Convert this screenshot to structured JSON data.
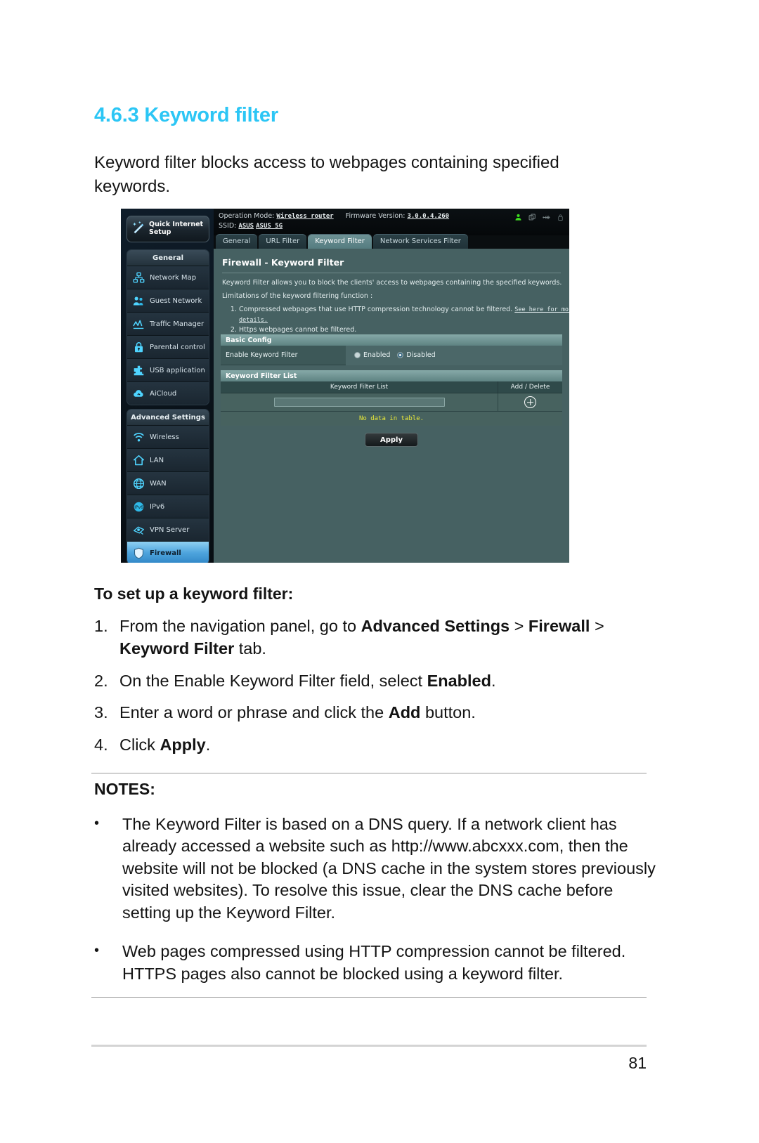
{
  "document": {
    "section_number": "4.6.3",
    "section_title": "Keyword filter",
    "heading": "4.6.3 Keyword filter",
    "intro": "Keyword filter blocks access to webpages containing specified keywords.",
    "howto_heading": "To set up a keyword filter:",
    "page_number": "81",
    "accent_color": "#2CC6F5"
  },
  "steps": [
    {
      "num": "1.",
      "html": "From the navigation panel, go to <b>Advanced Settings</b> &gt; <b>Firewall</b> &gt; <b>Keyword Filter</b> tab."
    },
    {
      "num": "2.",
      "html": "On the Enable Keyword Filter field, select <b>Enabled</b>."
    },
    {
      "num": "3.",
      "html": "Enter a word or phrase and click the <b>Add</b> button."
    },
    {
      "num": "4.",
      "html": "Click <b>Apply</b>."
    }
  ],
  "notes": {
    "title": "NOTES:",
    "items": [
      "The Keyword Filter is based on a DNS query. If a network client has already accessed a website such as http://www.abcxxx.com, then the website will not be blocked (a DNS cache in the system stores previously visited websites). To resolve this issue, clear the DNS cache before setting up the Keyword Filter.",
      "Web pages compressed using HTTP compression cannot be filtered. HTTPS pages also cannot be blocked using a keyword filter."
    ]
  },
  "router_ui": {
    "topbar": {
      "operation_mode_label": "Operation Mode:",
      "operation_mode_value": "Wireless router",
      "firmware_label": "Firmware Version:",
      "firmware_value": "3.0.0.4.260",
      "ssid_label": "SSID:",
      "ssid_value_1": "ASUS",
      "ssid_value_2": "ASUS_5G",
      "icons": [
        "user-icon",
        "copy-icon",
        "usb-icon",
        "lock-icon"
      ]
    },
    "quick_setup": {
      "line1": "Quick Internet",
      "line2": "Setup"
    },
    "nav_general": {
      "header": "General",
      "items": [
        {
          "label": "Network Map",
          "icon": "network-map-icon"
        },
        {
          "label": "Guest Network",
          "icon": "guest-network-icon"
        },
        {
          "label": "Traffic Manager",
          "icon": "traffic-manager-icon"
        },
        {
          "label": "Parental control",
          "icon": "parental-control-icon"
        },
        {
          "label": "USB application",
          "icon": "usb-application-icon"
        },
        {
          "label": "AiCloud",
          "icon": "aicloud-icon"
        }
      ]
    },
    "nav_advanced": {
      "header": "Advanced Settings",
      "items": [
        {
          "label": "Wireless",
          "icon": "wireless-icon",
          "active": false
        },
        {
          "label": "LAN",
          "icon": "lan-icon",
          "active": false
        },
        {
          "label": "WAN",
          "icon": "wan-icon",
          "active": false
        },
        {
          "label": "IPv6",
          "icon": "ipv6-icon",
          "active": false
        },
        {
          "label": "VPN Server",
          "icon": "vpn-server-icon",
          "active": false
        },
        {
          "label": "Firewall",
          "icon": "firewall-icon",
          "active": true
        }
      ]
    },
    "tabs": [
      {
        "label": "General",
        "selected": false
      },
      {
        "label": "URL Filter",
        "selected": false
      },
      {
        "label": "Keyword Filter",
        "selected": true
      },
      {
        "label": "Network Services Filter",
        "selected": false
      }
    ],
    "content": {
      "title": "Firewall - Keyword Filter",
      "description": "Keyword Filter allows you to block the clients' access to webpages containing the specified keywords.",
      "limitations_label": "Limitations of the keyword filtering function :",
      "limitation_1": "Compressed webpages that use HTTP compression technology cannot be filtered.",
      "limitation_1_link": "See here for more details.",
      "limitation_2": "Https webpages cannot be filtered.",
      "basic_config_header": "Basic Config",
      "enable_label": "Enable Keyword Filter",
      "radio_enabled": "Enabled",
      "radio_disabled": "Disabled",
      "selected_radio": "Disabled",
      "list_header": "Keyword Filter List",
      "col_keyword": "Keyword Filter List",
      "col_add_delete": "Add / Delete",
      "keyword_input_value": "",
      "keyword_input_placeholder": "",
      "no_data": "No data in table.",
      "apply_label": "Apply"
    }
  }
}
